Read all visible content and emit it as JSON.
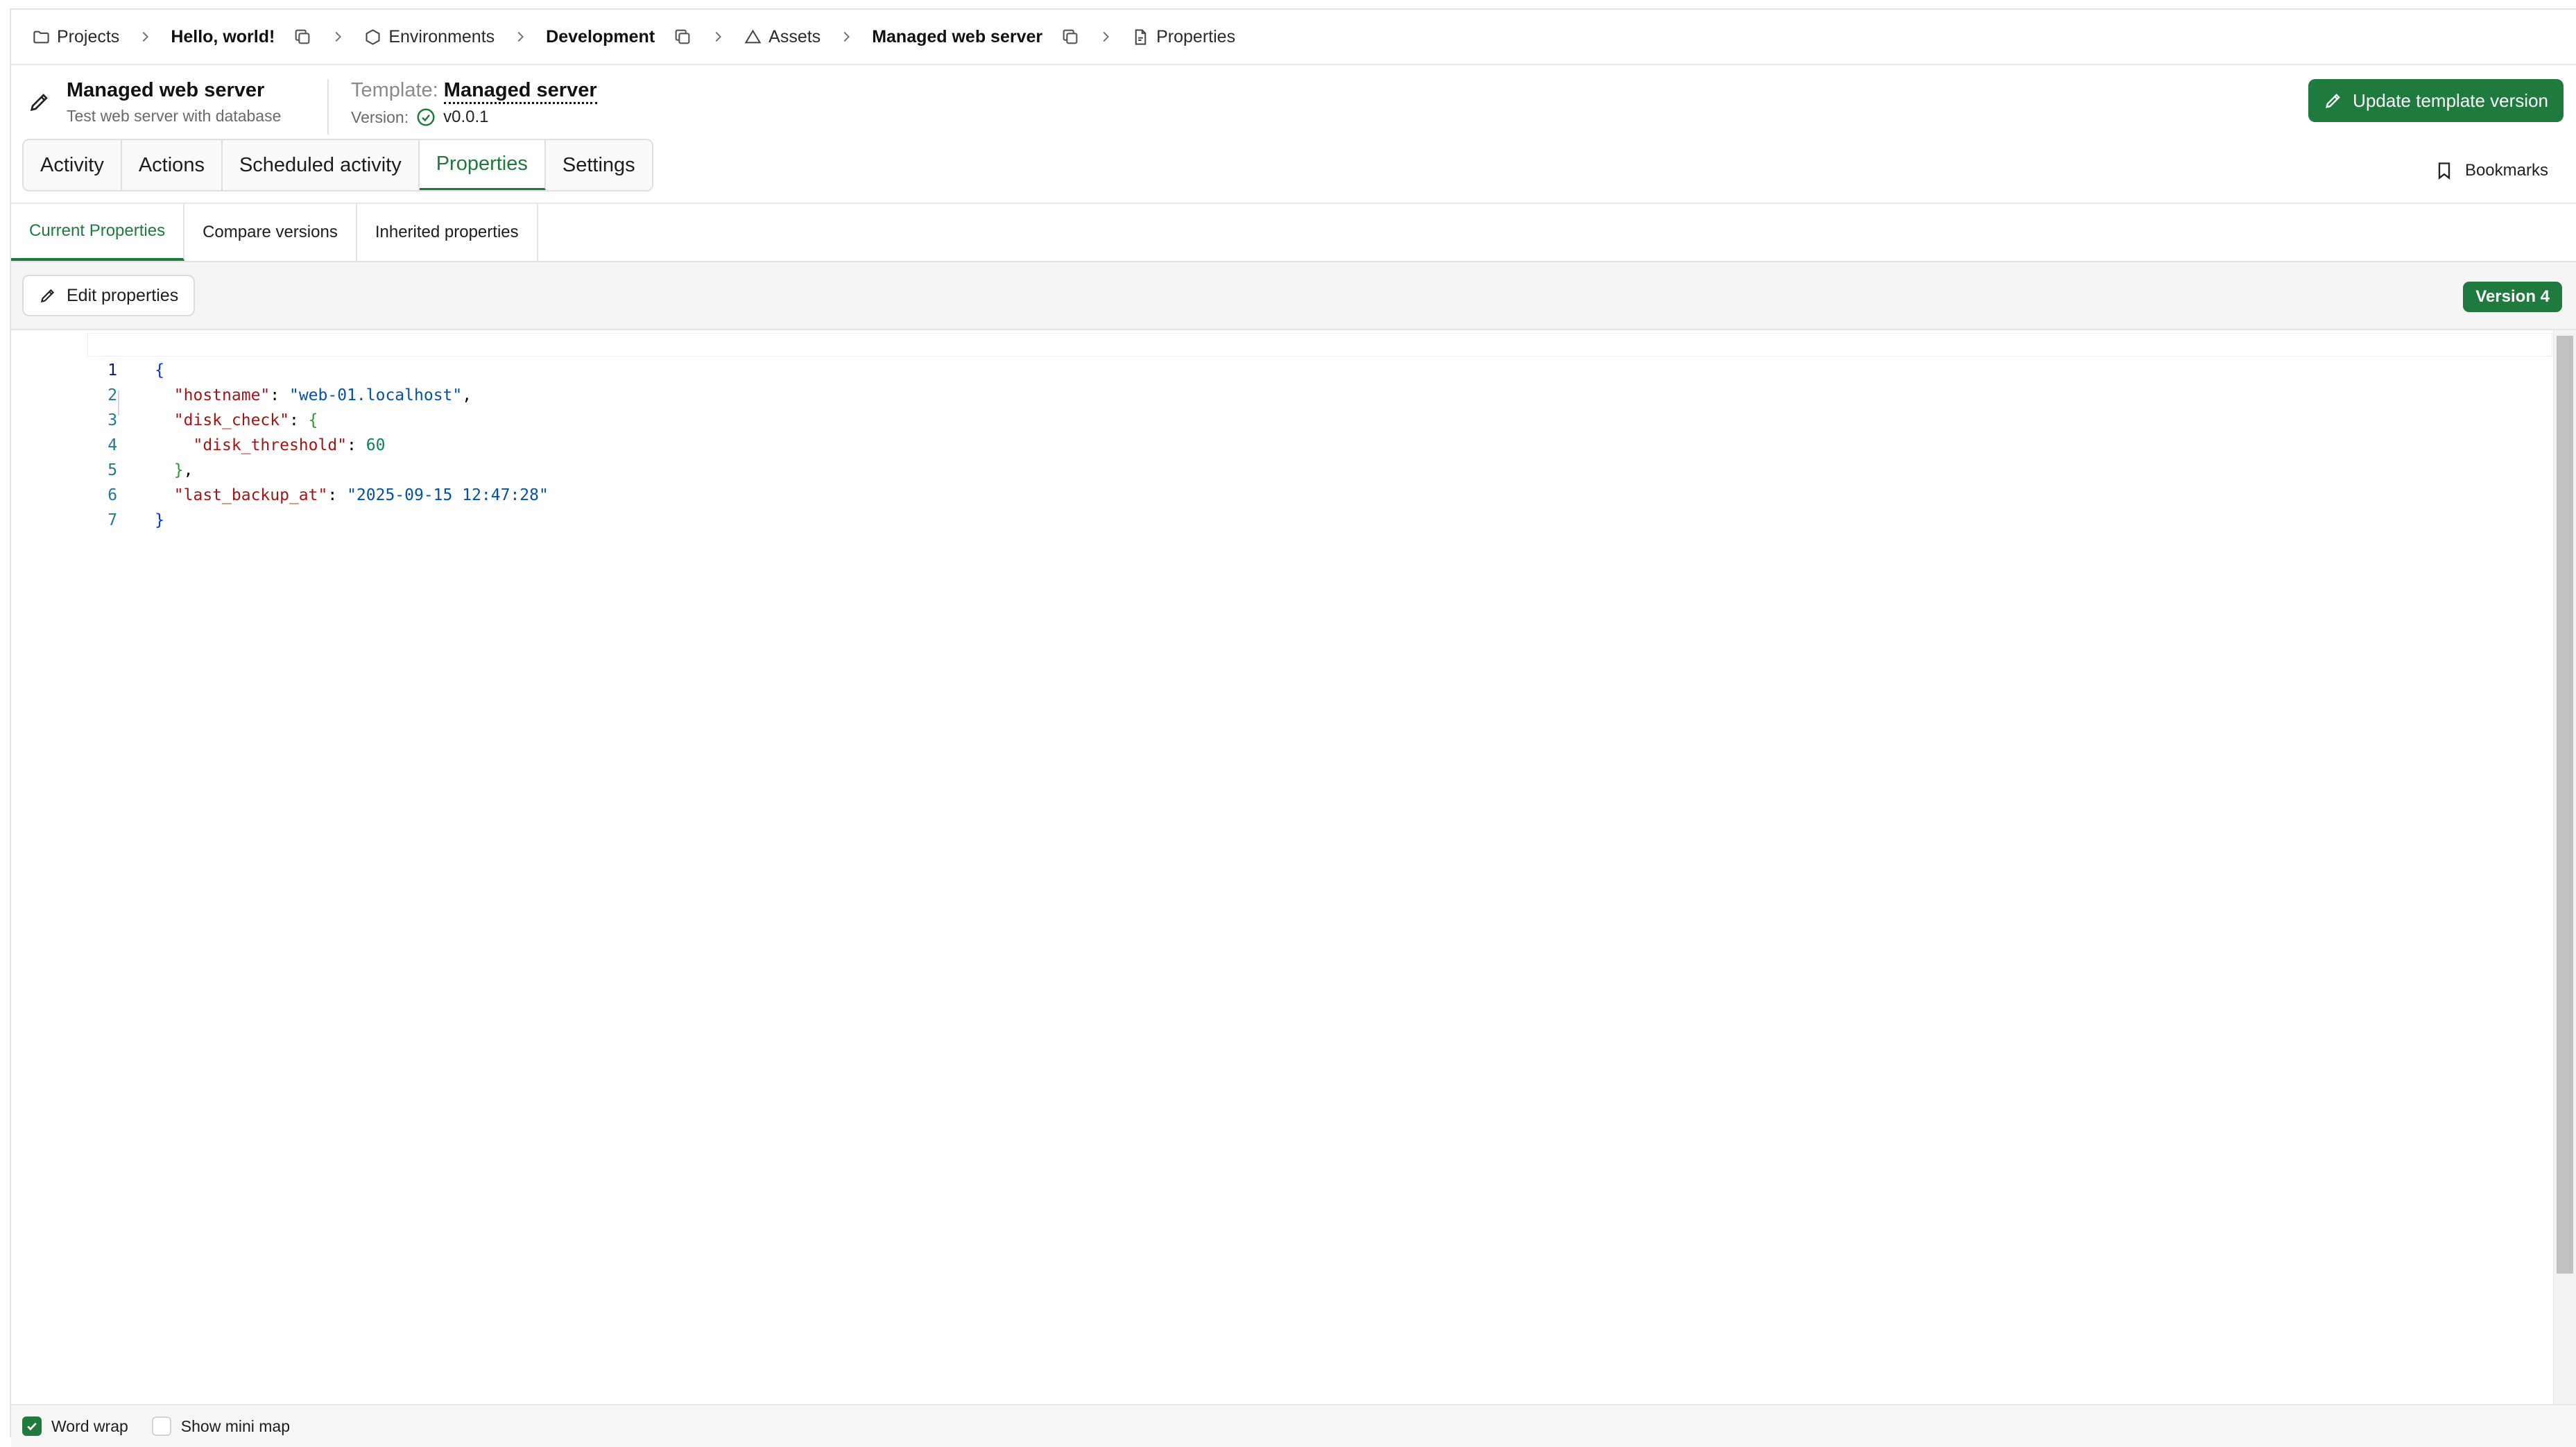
{
  "breadcrumb": {
    "projects": "Projects",
    "project": "Hello, world!",
    "environments": "Environments",
    "environment": "Development",
    "assets": "Assets",
    "asset": "Managed web server",
    "properties": "Properties"
  },
  "header": {
    "title": "Managed web server",
    "description": "Test web server with database",
    "template_label": "Template:",
    "template_name": "Managed server",
    "version_label": "Version:",
    "version_value": "v0.0.1",
    "update_button": "Update template version"
  },
  "tabs": [
    {
      "label": "Activity"
    },
    {
      "label": "Actions"
    },
    {
      "label": "Scheduled activity"
    },
    {
      "label": "Properties"
    },
    {
      "label": "Settings"
    }
  ],
  "bookmarks_label": "Bookmarks",
  "subtabs": [
    {
      "label": "Current Properties"
    },
    {
      "label": "Compare versions"
    },
    {
      "label": "Inherited properties"
    }
  ],
  "toolbar": {
    "edit_button": "Edit properties",
    "version_badge": "Version 4"
  },
  "editor": {
    "line_numbers": [
      "1",
      "2",
      "3",
      "4",
      "5",
      "6",
      "7"
    ],
    "keys": {
      "hostname": "\"hostname\"",
      "disk_check": "\"disk_check\"",
      "disk_threshold": "\"disk_threshold\"",
      "last_backup_at": "\"last_backup_at\""
    },
    "values": {
      "hostname": "\"web-01.localhost\"",
      "disk_threshold": "60",
      "last_backup_at": "\"2025-09-15 12:47:28\""
    }
  },
  "footer": {
    "word_wrap": "Word wrap",
    "mini_map": "Show mini map"
  },
  "colors": {
    "accent": "#1f7a3d",
    "json_key": "#a31515",
    "json_string": "#0451a5",
    "json_number": "#098658"
  }
}
